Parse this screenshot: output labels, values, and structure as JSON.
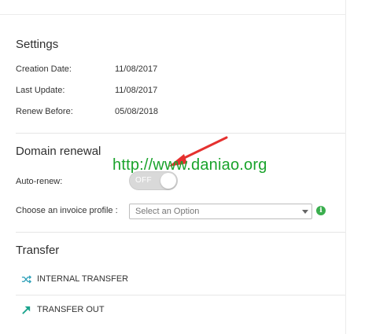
{
  "settings": {
    "title": "Settings",
    "rows": [
      {
        "label": "Creation Date:",
        "value": "11/08/2017"
      },
      {
        "label": "Last Update:",
        "value": "11/08/2017"
      },
      {
        "label": "Renew Before:",
        "value": "05/08/2018"
      }
    ]
  },
  "domain_renewal": {
    "title": "Domain renewal",
    "auto_renew_label": "Auto-renew:",
    "toggle_state": "OFF",
    "invoice_profile_label": "Choose an invoice profile :",
    "invoice_profile_select": {
      "selected": "Select an Option"
    },
    "info_icon": "info-circle-icon"
  },
  "transfer": {
    "title": "Transfer",
    "links": [
      {
        "label": "INTERNAL TRANSFER",
        "icon": "shuffle-icon"
      },
      {
        "label": "TRANSFER OUT",
        "icon": "arrow-up-right-icon"
      }
    ]
  },
  "watermark": {
    "text": "http://www.daniao.org"
  },
  "colors": {
    "accent_green": "#3aae4e",
    "watermark_green": "#1aa32c",
    "annotation_red": "#e5312f",
    "toggle_off": "#d9d9d9"
  }
}
